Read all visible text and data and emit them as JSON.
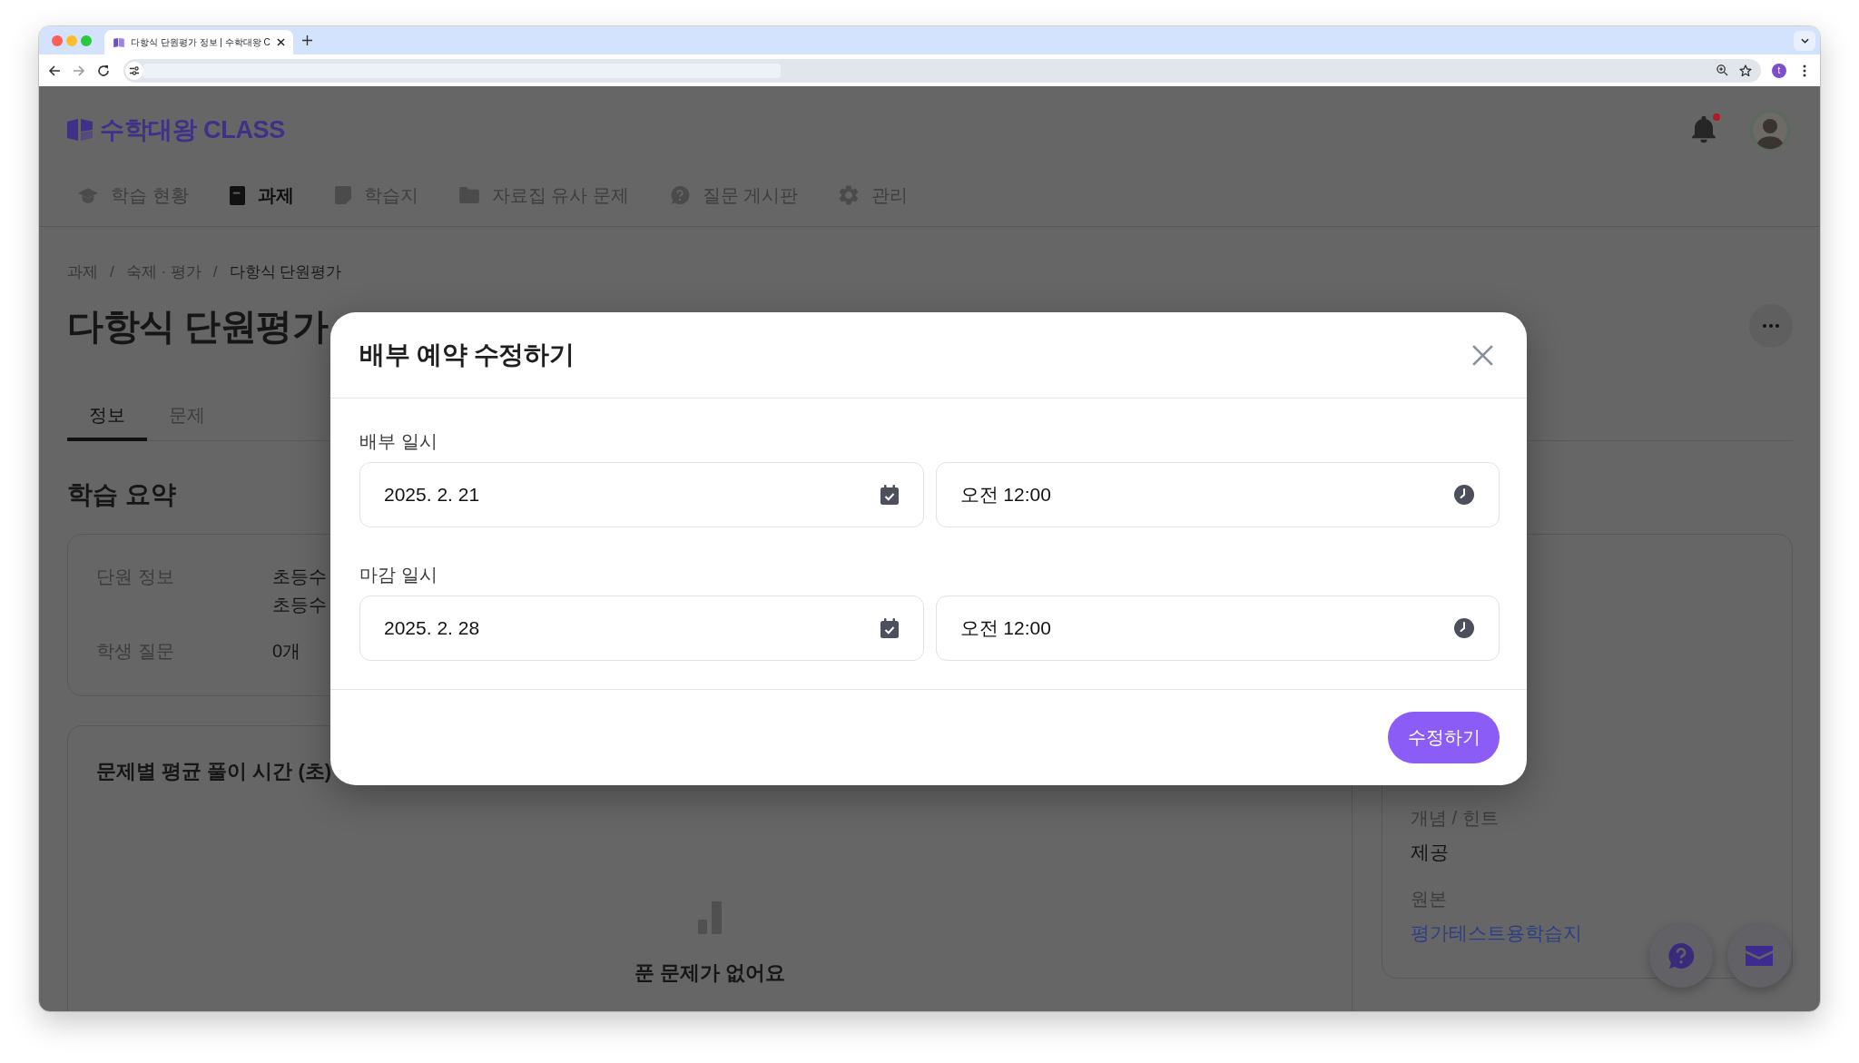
{
  "browser": {
    "tab_title": "다항식 단원평가 정보 | 수학대왕 C",
    "profile_initial": "t"
  },
  "header": {
    "logo": "수학대왕 CLASS",
    "has_unread": true
  },
  "nav": [
    {
      "label": "학습 현황",
      "selected": false
    },
    {
      "label": "과제",
      "selected": true
    },
    {
      "label": "학습지",
      "selected": false
    },
    {
      "label": "자료집 유사 문제",
      "selected": false
    },
    {
      "label": "질문 게시판",
      "selected": false
    },
    {
      "label": "관리",
      "selected": false
    }
  ],
  "breadcrumb": {
    "items": [
      "과제",
      "숙제 · 평가",
      "다항식 단원평가"
    ],
    "separators": [
      "/",
      "/"
    ]
  },
  "title": "다항식 단원평가",
  "tabs": [
    {
      "label": "정보",
      "selected": true
    },
    {
      "label": "문제",
      "selected": false
    }
  ],
  "summary": {
    "heading": "학습 요약",
    "rows": [
      {
        "label": "단원 정보",
        "values": [
          "초등수",
          "초등수"
        ]
      },
      {
        "label": "학생 질문",
        "values": [
          "0개"
        ]
      }
    ]
  },
  "chart_card": {
    "title": "문제별 평균 풀이 시간 (초)",
    "empty_message": "푼 문제가 없어요"
  },
  "details": [
    {
      "kind": "text",
      "label": "개념 / 힌트",
      "value": "제공"
    },
    {
      "kind": "link",
      "label": "원본",
      "value": "평가테스트용학습지"
    }
  ],
  "modal": {
    "title": "배부 예약 수정하기",
    "fields": [
      {
        "label": "배부 일시",
        "date": "2025. 2. 21",
        "time": "오전 12:00"
      },
      {
        "label": "마감 일시",
        "date": "2025. 2. 28",
        "time": "오전 12:00"
      }
    ],
    "submit": "수정하기"
  }
}
